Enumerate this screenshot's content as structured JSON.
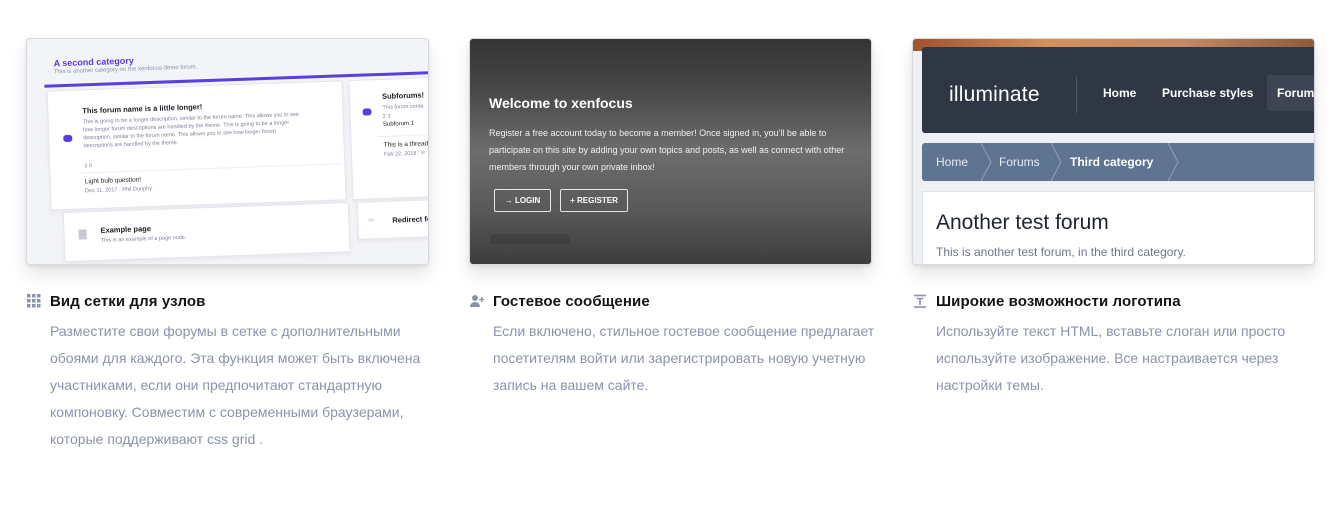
{
  "features": [
    {
      "title": "Вид сетки для узлов",
      "icon": "grid-icon",
      "description": "Разместите свои форумы в сетке с дополнительными обоями для каждого. Эта функция может быть включена участниками, если они предпочитают стандартную компоновку. Совместим с современными браузерами, которые поддерживают css grid .",
      "preview": {
        "category_title": "A second category",
        "category_description": "This is another category on the xenfocus demo forum.",
        "forum_title": "This forum name is a little longer!",
        "forum_description": "This is going to be a longer description, similar to the forum name. This allows you to see how longer forum descriptions are handled by the theme. This is going to be a longer description, similar to the forum name. This allows you to see how longer forum descriptions are handled by the theme.",
        "forum_stats": "3   0",
        "latest_title": "Light bulb question!",
        "latest_meta": "Dec 11, 2017 · Phil Dunphy",
        "subforum_title": "Subforums!",
        "subforum_desc": "This forum conta",
        "subforum_stats": "2   3",
        "subforum_link": "Subforum 1",
        "thread_title": "This is a thread",
        "thread_meta": "Feb 22, 2018 · P",
        "page_title": "Example page",
        "page_desc": "This is an example of a page node.",
        "redirect_title": "Redirect for"
      }
    },
    {
      "title": "Гостевое сообщение",
      "icon": "add-user-icon",
      "description": "Если включено, стильное гостевое сообщение предлагает посетителям войти или зарегистрировать новую учетную запись на вашем сайте.",
      "preview": {
        "title": "Welcome to xenfocus",
        "body": "Register a free account today to become a member! Once signed in, you'll be able to participate on this site by adding your own topics and posts, as well as connect with other members through your own private inbox!",
        "login_label": "→ LOGIN",
        "register_label": "+ REGISTER"
      }
    },
    {
      "title": "Широкие возможности логотипа",
      "icon": "text-logo-icon",
      "description": "Используйте текст HTML, вставьте слоган или просто используйте изображение. Все настраивается через настройки темы.",
      "preview": {
        "logo": "illuminate",
        "nav": [
          "Home",
          "Purchase styles",
          "Forum"
        ],
        "breadcrumbs": [
          "Home",
          "Forums",
          "Third category"
        ],
        "forum_title": "Another test forum",
        "forum_description": "This is another test forum, in the third category."
      }
    }
  ],
  "colors": {
    "accent_purple": "#5a3fe0",
    "title_text": "#141414",
    "desc_text": "#8a93a8",
    "illuminate_header": "#2f3745",
    "illuminate_breadcrumb": "#5f7491"
  }
}
